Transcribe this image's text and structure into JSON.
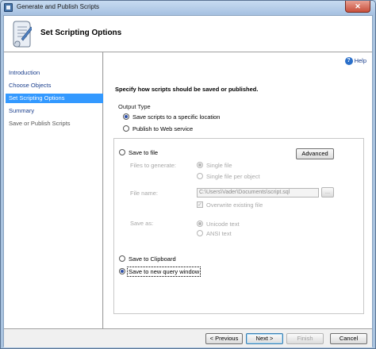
{
  "window": {
    "title": "Generate and Publish Scripts",
    "close_glyph": "✕"
  },
  "header": {
    "title": "Set Scripting Options",
    "icon": "scroll-icon"
  },
  "nav": {
    "items": [
      {
        "label": "Introduction",
        "state": "link"
      },
      {
        "label": "Choose Objects",
        "state": "link"
      },
      {
        "label": "Set Scripting Options",
        "state": "active"
      },
      {
        "label": "Summary",
        "state": "link"
      },
      {
        "label": "Save or Publish Scripts",
        "state": "disabled"
      }
    ]
  },
  "main": {
    "help_label": "Help",
    "help_glyph": "?",
    "instruction": "Specify how scripts should be saved or published.",
    "output_type": {
      "label": "Output Type",
      "options": [
        {
          "label": "Save scripts to a specific location",
          "selected": true
        },
        {
          "label": "Publish to Web service",
          "selected": false
        }
      ]
    },
    "save_to_file": {
      "label": "Save to file",
      "selected": false,
      "advanced_button": "Advanced",
      "files_to_generate_label": "Files to generate:",
      "files_options": [
        {
          "label": "Single file",
          "selected": true
        },
        {
          "label": "Single file per object",
          "selected": false
        }
      ],
      "file_name_label": "File name:",
      "file_name_value": "C:\\Users\\Vader\\Documents\\script.sql",
      "browse_button": "...",
      "overwrite_label": "Overwrite existing file",
      "overwrite_checked": true,
      "check_glyph": "✓",
      "save_as_label": "Save as:",
      "save_as_options": [
        {
          "label": "Unicode text",
          "selected": true
        },
        {
          "label": "ANSI text",
          "selected": false
        }
      ]
    },
    "save_to_clipboard": {
      "label": "Save to Clipboard",
      "selected": false
    },
    "save_to_query_window": {
      "label": "Save to new query window",
      "selected": true
    }
  },
  "footer": {
    "previous": "< Previous",
    "next": "Next >",
    "finish": "Finish",
    "cancel": "Cancel"
  },
  "colors": {
    "active_nav": "#3399ff",
    "link": "#1a3e8c",
    "radio_dot": "#2b4ea8"
  }
}
